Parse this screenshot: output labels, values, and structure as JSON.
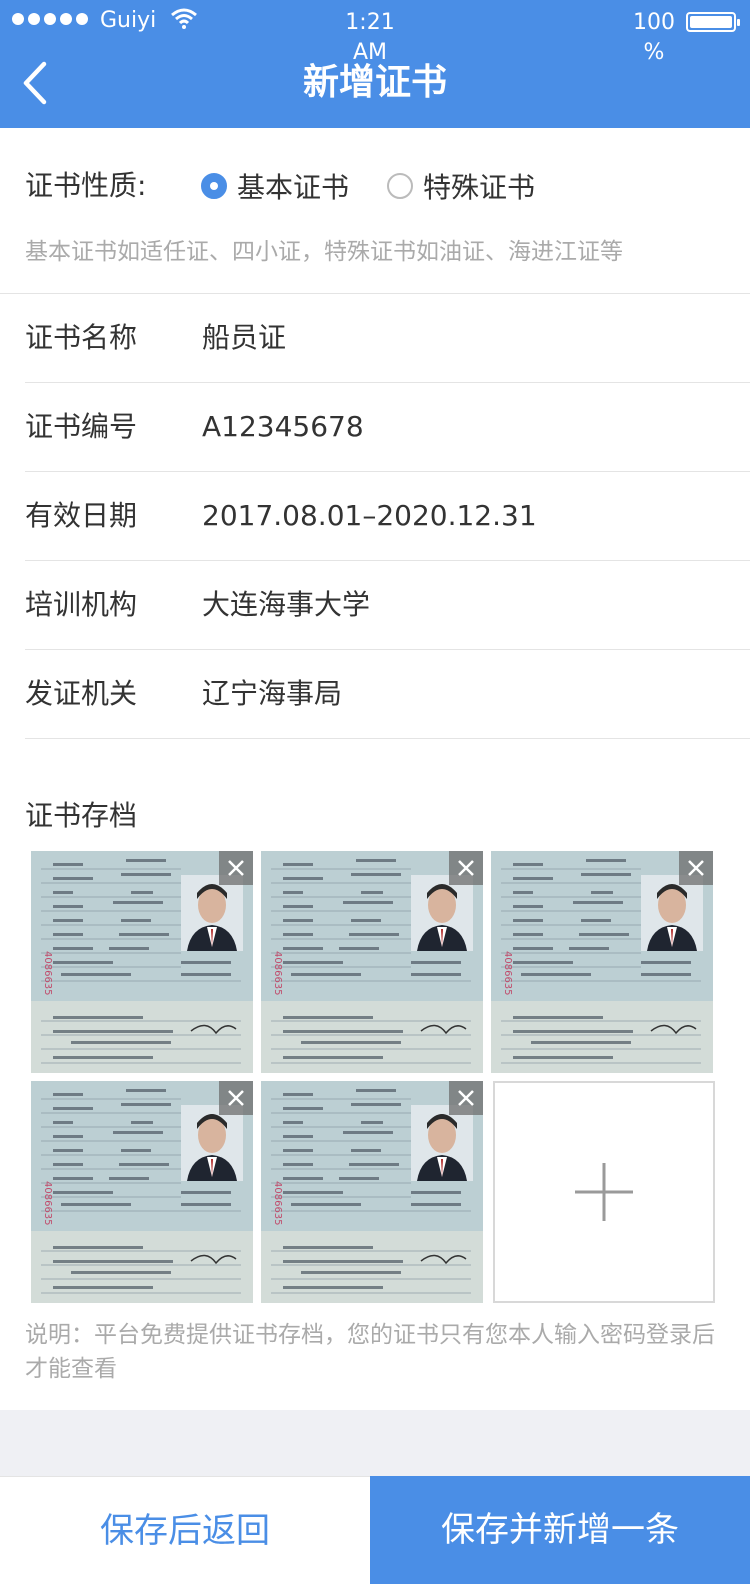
{
  "status_bar": {
    "carrier": "Guiyi",
    "time_line1": "1:21",
    "time_line2": "AM",
    "battery_line1": "100",
    "battery_line2": "%"
  },
  "header": {
    "title": "新增证书"
  },
  "nature": {
    "label": "证书性质:",
    "options": [
      {
        "label": "基本证书",
        "checked": true
      },
      {
        "label": "特殊证书",
        "checked": false
      }
    ],
    "hint": "基本证书如适任证、四小证，特殊证书如油证、海进江证等"
  },
  "form": {
    "fields": [
      {
        "label": "证书名称",
        "value": "船员证"
      },
      {
        "label": "证书编号",
        "value": "A12345678"
      },
      {
        "label": "有效日期",
        "value": "2017.08.01–2020.12.31"
      },
      {
        "label": "培训机构",
        "value": "大连海事大学"
      },
      {
        "label": "发证机关",
        "value": "辽宁海事局"
      }
    ]
  },
  "archive": {
    "title": "证书存档",
    "note": "说明：平台免费提供证书存档，您的证书只有您本人输入密码登录后才能查看",
    "photo_count": 5,
    "add_icon": "plus-icon"
  },
  "footer": {
    "return_label": "保存后返回",
    "save_new_label": "保存并新增一条"
  },
  "colors": {
    "accent": "#4a8ee6",
    "hint": "#aaaaaa",
    "divider": "#e4e4e4"
  }
}
